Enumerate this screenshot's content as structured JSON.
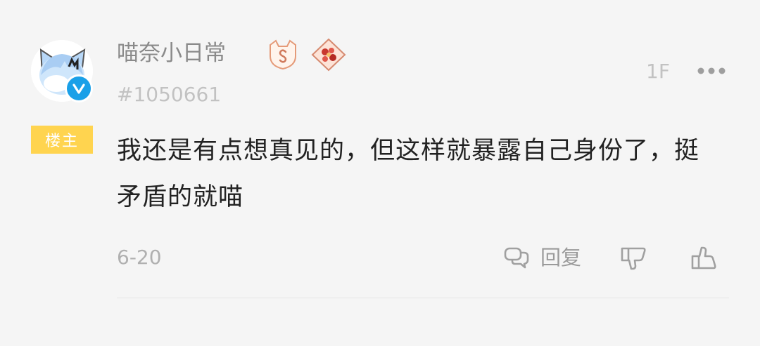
{
  "post": {
    "username": "喵奈小日常",
    "user_id": "#1050661",
    "op_badge": "楼主",
    "floor": "1F",
    "content": "我还是有点想真见的，但这样就暴露自己身份了，挺矛盾的就喵",
    "date": "6-20",
    "reply_label": "回复"
  },
  "icons": {
    "more": "more-icon",
    "reply": "comment-icon",
    "dislike": "thumbs-down-icon",
    "like": "thumbs-up-icon",
    "verified": "verified-check-icon"
  },
  "colors": {
    "background": "#f5f5f5",
    "op_badge": "#ffd44f",
    "verified": "#1aa0e8",
    "text_primary": "#222222",
    "text_secondary": "#8a8a8a"
  }
}
